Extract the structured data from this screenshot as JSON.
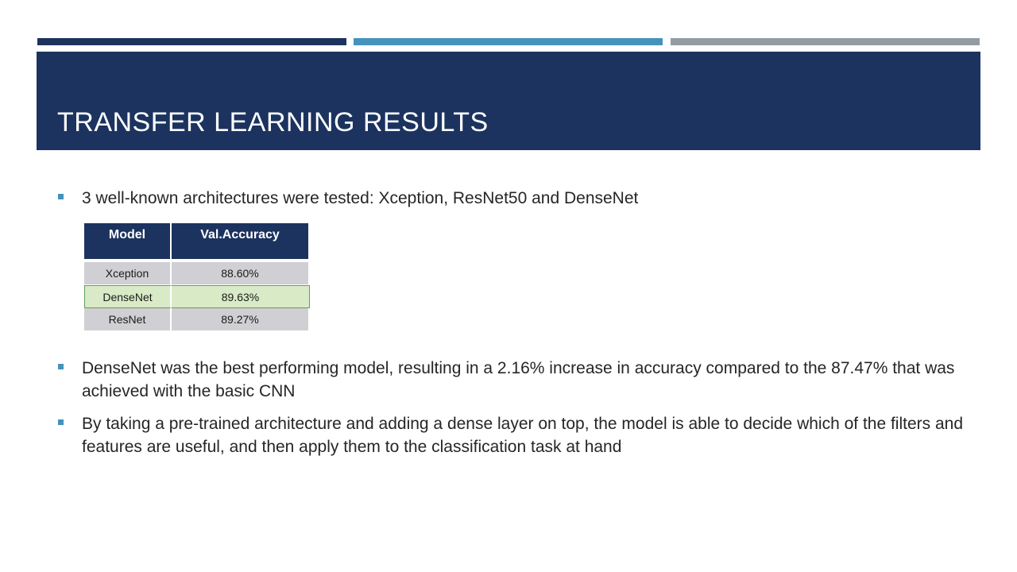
{
  "slide": {
    "title": "TRANSFER LEARNING RESULTS",
    "accent_colors": [
      "#1c335f",
      "#4492bd",
      "#939ba3"
    ]
  },
  "bullets": [
    "3 well-known architectures were tested: Xception, ResNet50 and DenseNet",
    "DenseNet was the best performing model, resulting in a 2.16% increase in accuracy compared to the 87.47% that was achieved with the basic CNN",
    "By taking a pre-trained architecture and adding a dense layer on top, the model is able to decide which of the filters and features are useful, and then apply them to the classification task at hand"
  ],
  "results_table": {
    "headers": [
      "Model",
      "Val.Accuracy"
    ],
    "rows": [
      {
        "model": "Xception",
        "accuracy": "88.60%"
      },
      {
        "model": "DenseNet",
        "accuracy": "89.63%",
        "highlighted": true
      },
      {
        "model": "ResNet",
        "accuracy": "89.27%"
      }
    ],
    "highlight_color": "#d9eac6"
  }
}
